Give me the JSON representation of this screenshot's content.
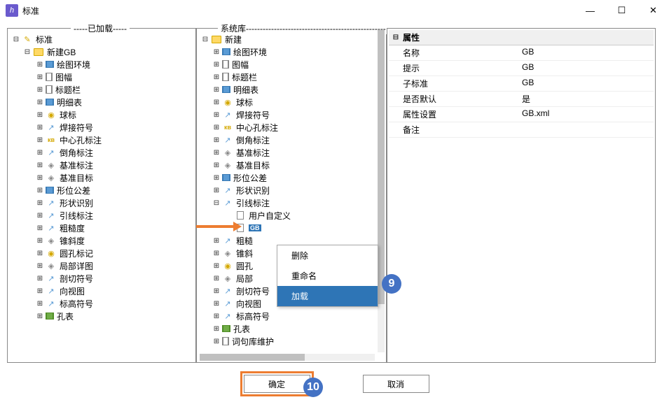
{
  "window": {
    "title": "标准",
    "app_icon_glyph": "h"
  },
  "panels": {
    "loaded": {
      "label": "-----已加载-----"
    },
    "system": {
      "label": "系统库--------------------------------------------------"
    }
  },
  "tree_left": {
    "root": "标准",
    "sub": "新建GB",
    "items": [
      "绘图环境",
      "图幅",
      "标题栏",
      "明细表",
      "球标",
      "焊接符号",
      "中心孔标注",
      "倒角标注",
      "基准标注",
      "基准目标",
      "形位公差",
      "形状识别",
      "引线标注",
      "粗糙度",
      "锥斜度",
      "圆孔标记",
      "局部详图",
      "剖切符号",
      "向视图",
      "标高符号",
      "孔表"
    ]
  },
  "tree_right": {
    "root": "新建",
    "items": [
      "绘图环境",
      "图幅",
      "标题栏",
      "明细表",
      "球标",
      "焊接符号",
      "中心孔标注",
      "倒角标注",
      "基准标注",
      "基准目标",
      "形位公差",
      "形状识别"
    ],
    "open_item": "引线标注",
    "open_children": {
      "user_custom": "用户自定义",
      "gb_sel": "GB"
    },
    "items_after": [
      "粗糙",
      "锥斜",
      "圆孔",
      "局部",
      "剖切符号",
      "向视图",
      "标高符号",
      "孔表",
      "词句库维护"
    ]
  },
  "context_menu": {
    "items": [
      {
        "label": "删除",
        "selected": false
      },
      {
        "label": "重命名",
        "selected": false
      },
      {
        "label": "加载",
        "selected": true
      }
    ]
  },
  "properties": {
    "header": "属性",
    "rows": [
      {
        "key": "名称",
        "val": "GB"
      },
      {
        "key": "提示",
        "val": "GB"
      },
      {
        "key": "子标准",
        "val": "GB"
      },
      {
        "key": "是否默认",
        "val": "是"
      },
      {
        "key": "属性设置",
        "val": "GB.xml"
      },
      {
        "key": "备注",
        "val": ""
      }
    ]
  },
  "buttons": {
    "ok": "确定",
    "cancel": "取消"
  },
  "callouts": {
    "nine": "9",
    "ten": "10"
  }
}
